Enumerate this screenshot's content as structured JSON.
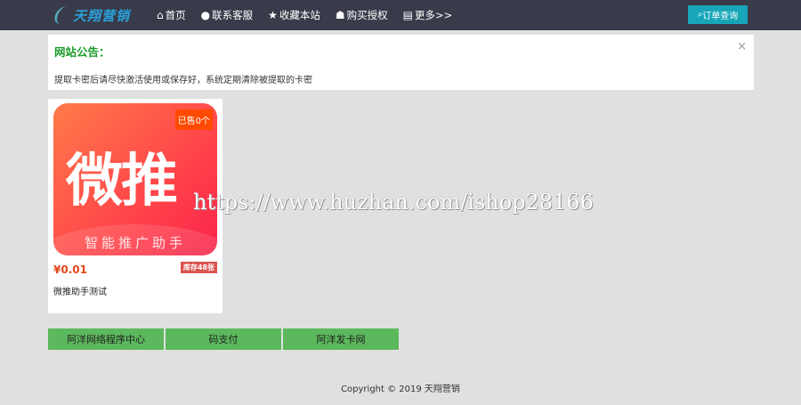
{
  "nav": {
    "logo": "天翔营销",
    "items": [
      {
        "icon": "home-icon",
        "glyph": "⌂",
        "label": "首页"
      },
      {
        "icon": "qq-icon",
        "glyph": "●",
        "label": "联系客服"
      },
      {
        "icon": "star-icon",
        "glyph": "★",
        "label": "收藏本站"
      },
      {
        "icon": "users-icon",
        "glyph": "☗",
        "label": "购买授权"
      },
      {
        "icon": "list-icon",
        "glyph": "▤",
        "label": "更多>>"
      }
    ],
    "order_button": "订单查询"
  },
  "notice": {
    "title": "网站公告：",
    "text": "提取卡密后请尽快激活使用或保存好，系统定期清除被提取的卡密",
    "close": "×"
  },
  "products": [
    {
      "image_title": "微推",
      "image_subtitle": "智能推广助手",
      "sold": "已售0个",
      "price": "¥0.01",
      "stock": "库存48张",
      "name": "微推助手测试"
    }
  ],
  "links": [
    "阿洋网络程序中心",
    "码支付",
    "阿洋发卡网"
  ],
  "watermark": "https://www.huzhan.com/ishop28166",
  "footer": "Copyright © 2019 天翔营销"
}
